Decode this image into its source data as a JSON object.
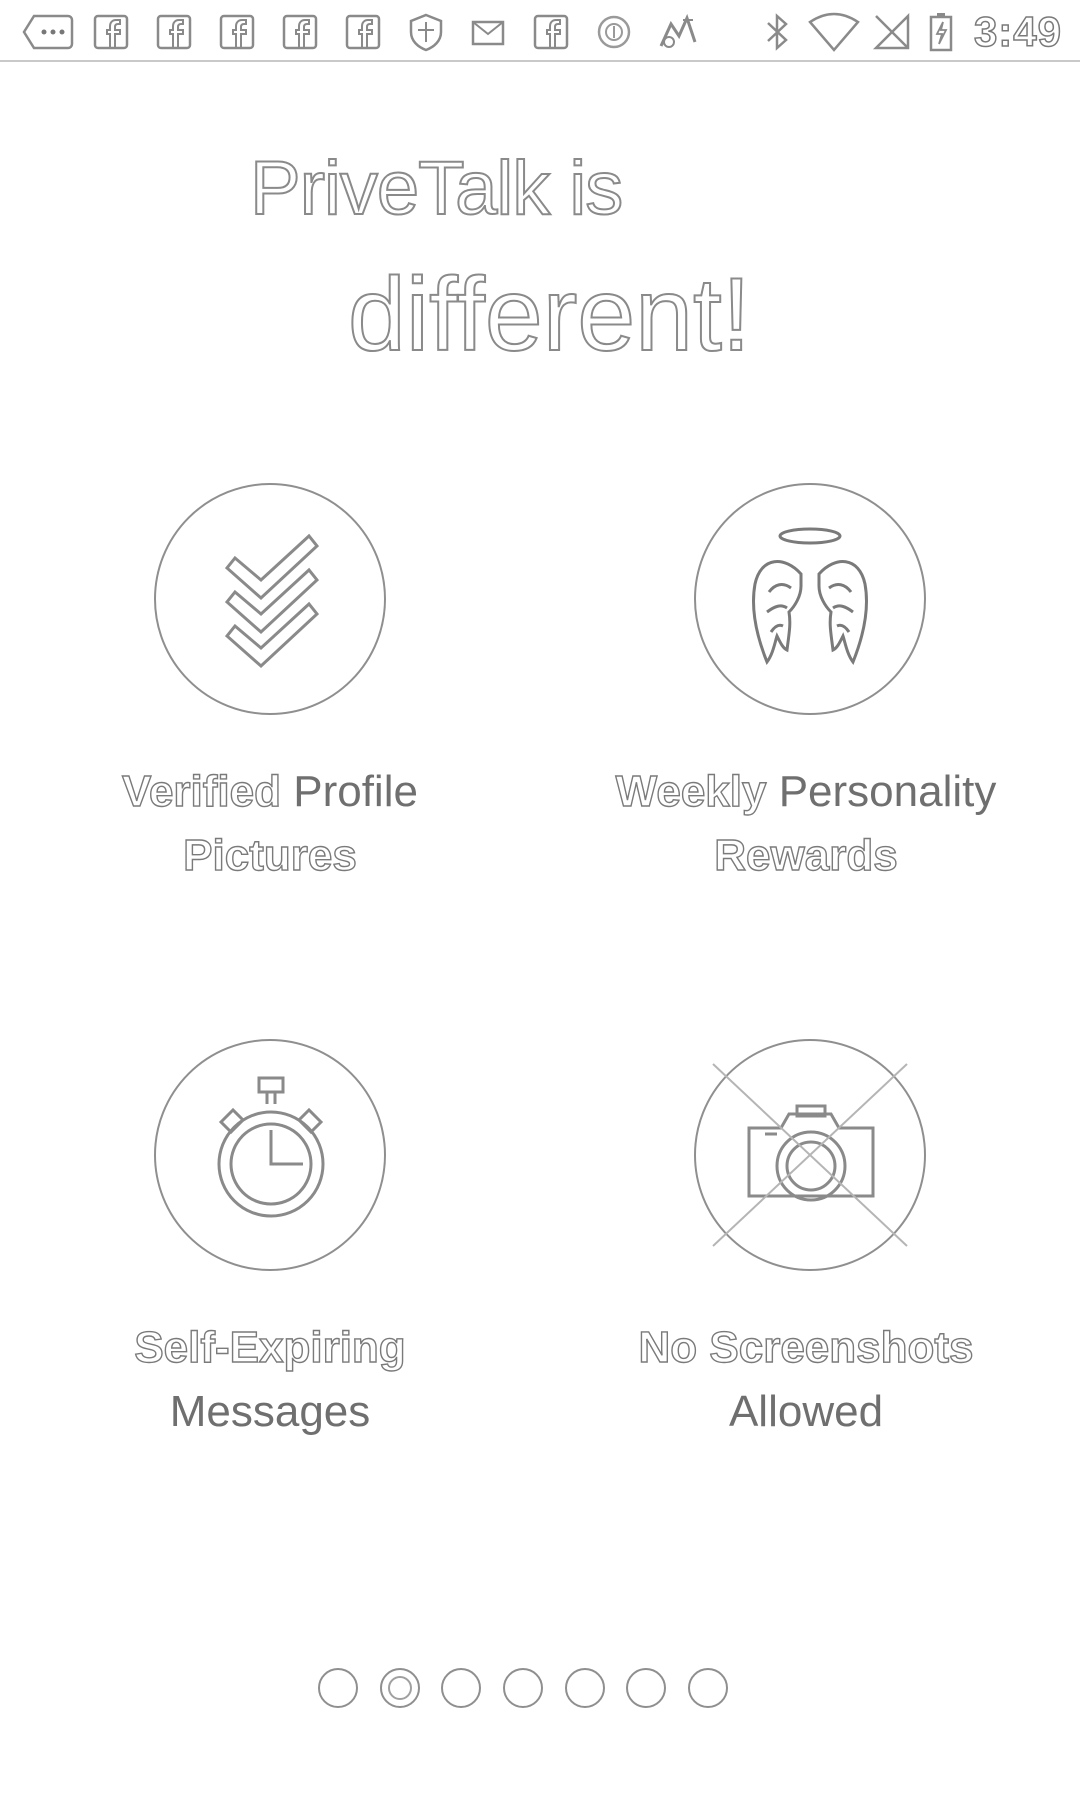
{
  "status_bar": {
    "time": "3:49",
    "notification_icons": [
      "more-notifications-icon",
      "facebook-icon",
      "facebook-icon",
      "facebook-icon",
      "facebook-icon",
      "facebook-icon",
      "shield-icon",
      "mail-icon",
      "facebook-icon",
      "circle-app-icon",
      "fart-app-icon"
    ],
    "system_icons": [
      "bluetooth-icon",
      "wifi-icon",
      "no-signal-icon",
      "battery-charging-icon"
    ]
  },
  "headline": {
    "line1": "PriveTalk is",
    "line2": "different!"
  },
  "features": [
    {
      "icon": "triple-check-icon",
      "bold": "Verified",
      "rest_line1": " Profile",
      "line2": "Pictures",
      "line2_bold": true
    },
    {
      "icon": "angel-wings-icon",
      "bold": "Weekly",
      "rest_line1": " Personality",
      "line2": "Rewards",
      "line2_bold": true
    },
    {
      "icon": "stopwatch-icon",
      "bold": "Self-Expiring",
      "rest_line1": "",
      "line2": "Messages",
      "line2_bold": false
    },
    {
      "icon": "no-camera-icon",
      "bold": "No Screenshots",
      "rest_line1": "",
      "line2": "Allowed",
      "line2_bold": false
    }
  ],
  "pager": {
    "total": 7,
    "active_index": 1
  }
}
